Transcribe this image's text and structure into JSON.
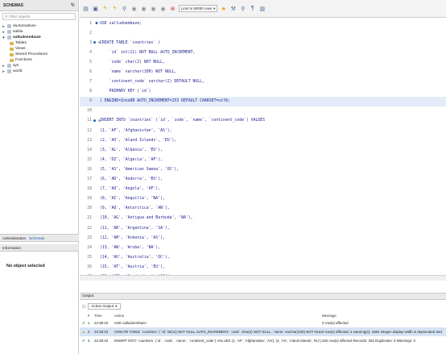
{
  "sidebar": {
    "title": "SCHEMAS",
    "filter_placeholder": "Filter objects",
    "tree": [
      {
        "label": "duotomativee",
        "level": 1,
        "expanded": false,
        "bold": false
      },
      {
        "label": "sakila",
        "level": 1,
        "expanded": false,
        "bold": false
      },
      {
        "label": "saltudoembaze",
        "level": 1,
        "expanded": true,
        "bold": true
      },
      {
        "label": "Tables",
        "level": 2
      },
      {
        "label": "Views",
        "level": 2
      },
      {
        "label": "Stored Procedures",
        "level": 2
      },
      {
        "label": "Functions",
        "level": 2
      },
      {
        "label": "sys",
        "level": 1,
        "expanded": false,
        "bold": false
      },
      {
        "label": "world",
        "level": 1,
        "expanded": false,
        "bold": false
      }
    ],
    "tabs": [
      "Administration",
      "Schemas"
    ],
    "info_title": "Information",
    "no_object": "No object selected"
  },
  "toolbar": {
    "limit_label": "Limit to 50000 rows"
  },
  "editor": {
    "lines": [
      {
        "n": "1",
        "marker": "●",
        "code": "USE salludoembaze;"
      },
      {
        "n": "2",
        "marker": "",
        "code": ""
      },
      {
        "n": "3",
        "marker": "● ⊖",
        "code": "CREATE TABLE `countries` ("
      },
      {
        "n": "4",
        "marker": "",
        "code": "    `id` int(11) NOT NULL AUTO_INCREMENT,"
      },
      {
        "n": "5",
        "marker": "",
        "code": "    `code` char(2) NOT NULL,"
      },
      {
        "n": "6",
        "marker": "",
        "code": "    `name` varchar(100) NOT NULL,"
      },
      {
        "n": "7",
        "marker": "",
        "code": "    `continent_code` varchar(2) DEFAULT NULL,"
      },
      {
        "n": "8",
        "marker": "",
        "code": "    PRIMARY KEY (`id`)"
      },
      {
        "n": "9",
        "marker": "",
        "code": ") ENGINE=InnoDB AUTO_INCREMENT=253 DEFAULT CHARSET=utf8;"
      },
      {
        "n": "10",
        "marker": "",
        "code": ""
      },
      {
        "n": "11",
        "marker": "● ⊖",
        "code": "INSERT INTO `countries` (`id`, `code`, `name`, `continent_code`) VALUES"
      },
      {
        "n": "12",
        "marker": "",
        "code": "(1, 'AF', 'Afghanistan', 'AS'),"
      },
      {
        "n": "13",
        "marker": "",
        "code": "(2, 'AX', 'Aland Islands', 'EU'),"
      },
      {
        "n": "14",
        "marker": "",
        "code": "(3, 'AL', 'Albania', 'EU'),"
      },
      {
        "n": "15",
        "marker": "",
        "code": "(4, 'DZ', 'Algeria', 'AF'),"
      },
      {
        "n": "16",
        "marker": "",
        "code": "(5, 'AS', 'American Samoa', 'OC'),"
      },
      {
        "n": "17",
        "marker": "",
        "code": "(6, 'AD', 'Andorra', 'EU'),"
      },
      {
        "n": "18",
        "marker": "",
        "code": "(7, 'AO', 'Angola', 'AF'),"
      },
      {
        "n": "19",
        "marker": "",
        "code": "(8, 'AI', 'Anguilla', 'NA'),"
      },
      {
        "n": "20",
        "marker": "",
        "code": "(9, 'AQ', 'Antarctica', 'AN'),"
      },
      {
        "n": "21",
        "marker": "",
        "code": "(10, 'AG', 'Antigua and Barbuda', 'NA'),"
      },
      {
        "n": "22",
        "marker": "",
        "code": "(11, 'AR', 'Argentina', 'SA'),"
      },
      {
        "n": "23",
        "marker": "",
        "code": "(12, 'AM', 'Armenia', 'AS'),"
      },
      {
        "n": "24",
        "marker": "",
        "code": "(13, 'AW', 'Aruba', 'NA'),"
      },
      {
        "n": "25",
        "marker": "",
        "code": "(14, 'AU', 'Australia', 'OC'),"
      },
      {
        "n": "26",
        "marker": "",
        "code": "(15, 'AT', 'Austria', 'EU'),"
      },
      {
        "n": "27",
        "marker": "",
        "code": "(16, 'AZ', 'Azerbaijan', 'AS'),"
      },
      {
        "n": "28",
        "marker": "",
        "code": "(17, 'BS', 'Bahamas', 'NA'),"
      },
      {
        "n": "29",
        "marker": "",
        "code": "(18, 'BH', 'Bahrain', 'AS'),"
      },
      {
        "n": "30",
        "marker": "",
        "code": "(19, 'BD', 'Bangladesh', 'AS'),"
      },
      {
        "n": "31",
        "marker": "",
        "code": "(20, 'BB', 'Barbados', 'NA'),"
      }
    ]
  },
  "output": {
    "title": "Output",
    "selector": "Action Output",
    "columns": [
      "#",
      "Time",
      "Action",
      "Message"
    ],
    "rows": [
      {
        "status": "ok",
        "num": "1",
        "time": "22:38:23",
        "action": "USE salludoembaze",
        "message": "0 row(s) affected"
      },
      {
        "status": "warn",
        "num": "2",
        "time": "22:38:23",
        "action": "CREATE TABLE `countries` (   `id` int(11) NOT NULL AUTO_INCREMENT,   `code` char(2) NOT NULL,   `name` varchar(100) NOT NULL, ...",
        "message": "0 row(s) affected, 2 warning(s): 1681 Integer display width is deprecated and will be removed in"
      },
      {
        "status": "ok",
        "num": "3",
        "time": "22:38:23",
        "action": "INSERT INTO `countries` (`id`, `code`, `name`, `continent_code`) VALUES (1, 'AF', 'Afghanistan', 'AS'), (2, 'AX', 'Aland Islands', 'EU'), (3, 'AL', 'Alban...",
        "message": "252 row(s) affected Records: 252  Duplicates: 0  Warnings: 0"
      }
    ]
  }
}
